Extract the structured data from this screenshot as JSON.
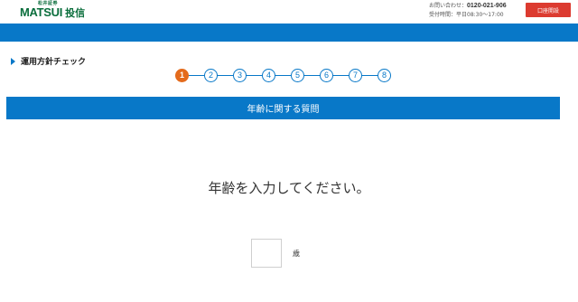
{
  "header": {
    "logo_small": "松井証券",
    "logo_brand": "MATSUI",
    "logo_suffix": "投信",
    "contact_label": "お問い合わせ：",
    "contact_phone": "0120-021-906",
    "hours": "受付時間：平日08:30～17:00",
    "account_button": "口座開設",
    "account_button_color": "#dc3b30"
  },
  "section": {
    "title": "運用方針チェック"
  },
  "steps": {
    "items": [
      "1",
      "2",
      "3",
      "4",
      "5",
      "6",
      "7",
      "8"
    ],
    "current": 1,
    "active_color": "#e46b1c",
    "color": "#0878c8"
  },
  "question": {
    "header": "年齢に関する質問",
    "prompt": "年齢を入力してください。",
    "input_value": "",
    "unit": "歳"
  },
  "colors": {
    "primary": "#0878c8",
    "brand_green": "#0a6e3c"
  }
}
